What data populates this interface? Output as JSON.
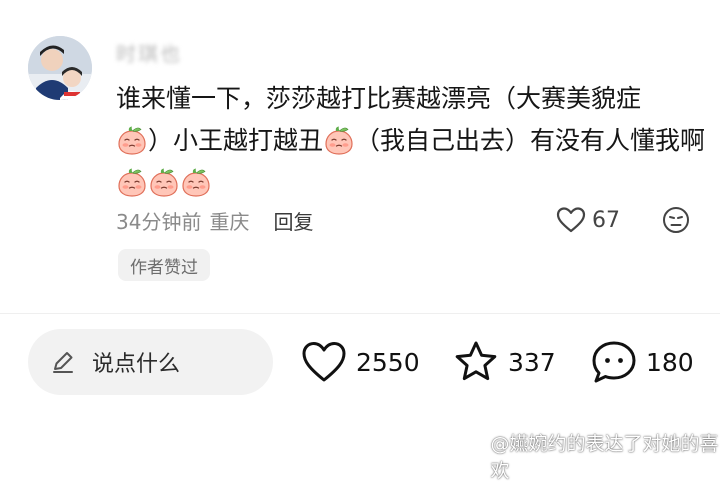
{
  "comment": {
    "username": "时琪也",
    "lines": [
      [
        {
          "t": "text",
          "v": "谁来懂一下，莎莎越打比赛越漂亮（大赛美貌症"
        }
      ],
      [
        {
          "t": "emoji"
        },
        {
          "t": "text",
          "v": "）小王越打越丑"
        },
        {
          "t": "emoji"
        },
        {
          "t": "text",
          "v": "（我自己出去）有没有人懂我啊"
        }
      ],
      [
        {
          "t": "emoji"
        },
        {
          "t": "emoji"
        },
        {
          "t": "emoji"
        }
      ]
    ],
    "time": "34分钟前",
    "location": "重庆",
    "reply_label": "回复",
    "like_count": "67",
    "author_badge": "作者赞过"
  },
  "bottom_bar": {
    "input_placeholder": "说点什么",
    "likes": "2550",
    "favorites": "337",
    "comments": "180"
  },
  "watermark": "@嬿婉约的表达了对她的喜欢",
  "icons": {
    "avatar": "avatar-photo",
    "emoji": "peach-face-emoji",
    "like": "heart-icon",
    "dislike": "dislike-face-icon",
    "input": "pencil-icon",
    "favorite": "star-icon",
    "comment": "comment-bubble-icon",
    "watermark": "weibo-icon"
  }
}
